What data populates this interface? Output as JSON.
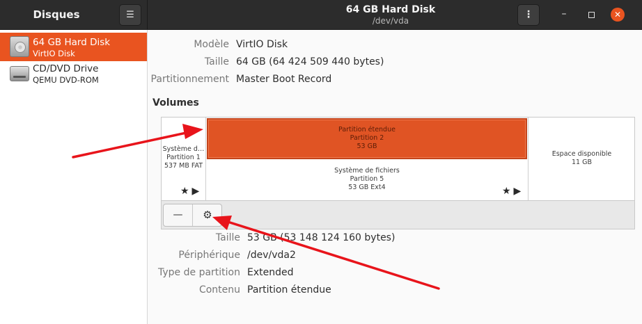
{
  "header": {
    "app_title": "Disques",
    "menu_icon": "☰",
    "window_title": "64 GB Hard Disk",
    "window_subtitle": "/dev/vda",
    "kebab_icon": "⋮",
    "minimize_icon": "–",
    "close_icon": "✕"
  },
  "sidebar": {
    "items": [
      {
        "name": "64 GB Hard Disk",
        "sub": "VirtIO Disk",
        "icon": "hard-disk-icon",
        "selected": true
      },
      {
        "name": "CD/DVD Drive",
        "sub": "QEMU DVD-ROM",
        "icon": "optical-drive-icon",
        "selected": false
      }
    ]
  },
  "disk_info": {
    "model_label": "Modèle",
    "model_value": "VirtIO Disk",
    "size_label": "Taille",
    "size_value": "64 GB (64 424 509 440 bytes)",
    "partitioning_label": "Partitionnement",
    "partitioning_value": "Master Boot Record"
  },
  "volumes": {
    "title": "Volumes",
    "partition1": {
      "line1": "Système d…",
      "line2": "Partition 1",
      "line3": "537 MB FAT",
      "icons": "★▶"
    },
    "extended": {
      "line1": "Partition étendue",
      "line2": "Partition 2",
      "line3": "53 GB"
    },
    "logical": {
      "line1": "Système de fichiers",
      "line2": "Partition 5",
      "line3": "53 GB Ext4",
      "icons": "★▶"
    },
    "free": {
      "line1": "Espace disponible",
      "line2": "11 GB"
    }
  },
  "toolbar": {
    "remove_icon": "—",
    "settings_icon": "⚙"
  },
  "selected_volume": {
    "size_label": "Taille",
    "size_value": "53 GB (53 148 124 160 bytes)",
    "device_label": "Périphérique",
    "device_value": "/dev/vda2",
    "type_label": "Type de partition",
    "type_value": "Extended",
    "contents_label": "Contenu",
    "contents_value": "Partition étendue"
  },
  "colors": {
    "accent": "#e95420",
    "header_bg": "#2c2c2c",
    "annotation_arrow": "#e8141b"
  }
}
